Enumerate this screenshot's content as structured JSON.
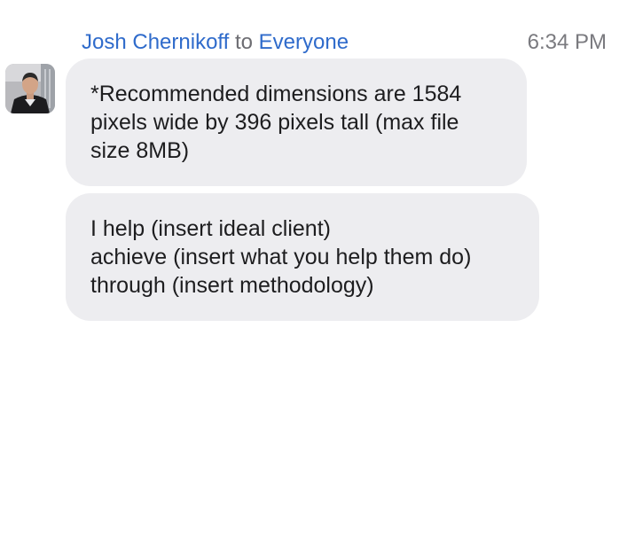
{
  "message": {
    "sender": "Josh Chernikoff",
    "connector": "to",
    "recipient": "Everyone",
    "timestamp": "6:34 PM"
  },
  "bubbles": [
    {
      "lines": [
        "*Recommended dimensions are 1584",
        "pixels wide by 396 pixels tall (max file",
        "size 8MB)"
      ]
    },
    {
      "lines": [
        "I help (insert ideal client)",
        "achieve (insert what you help them do)",
        "through (insert methodology)"
      ]
    }
  ],
  "colors": {
    "name_link": "#2f6bcb",
    "bubble_background": "#ededf0",
    "timestamp": "#7a7a7f"
  }
}
